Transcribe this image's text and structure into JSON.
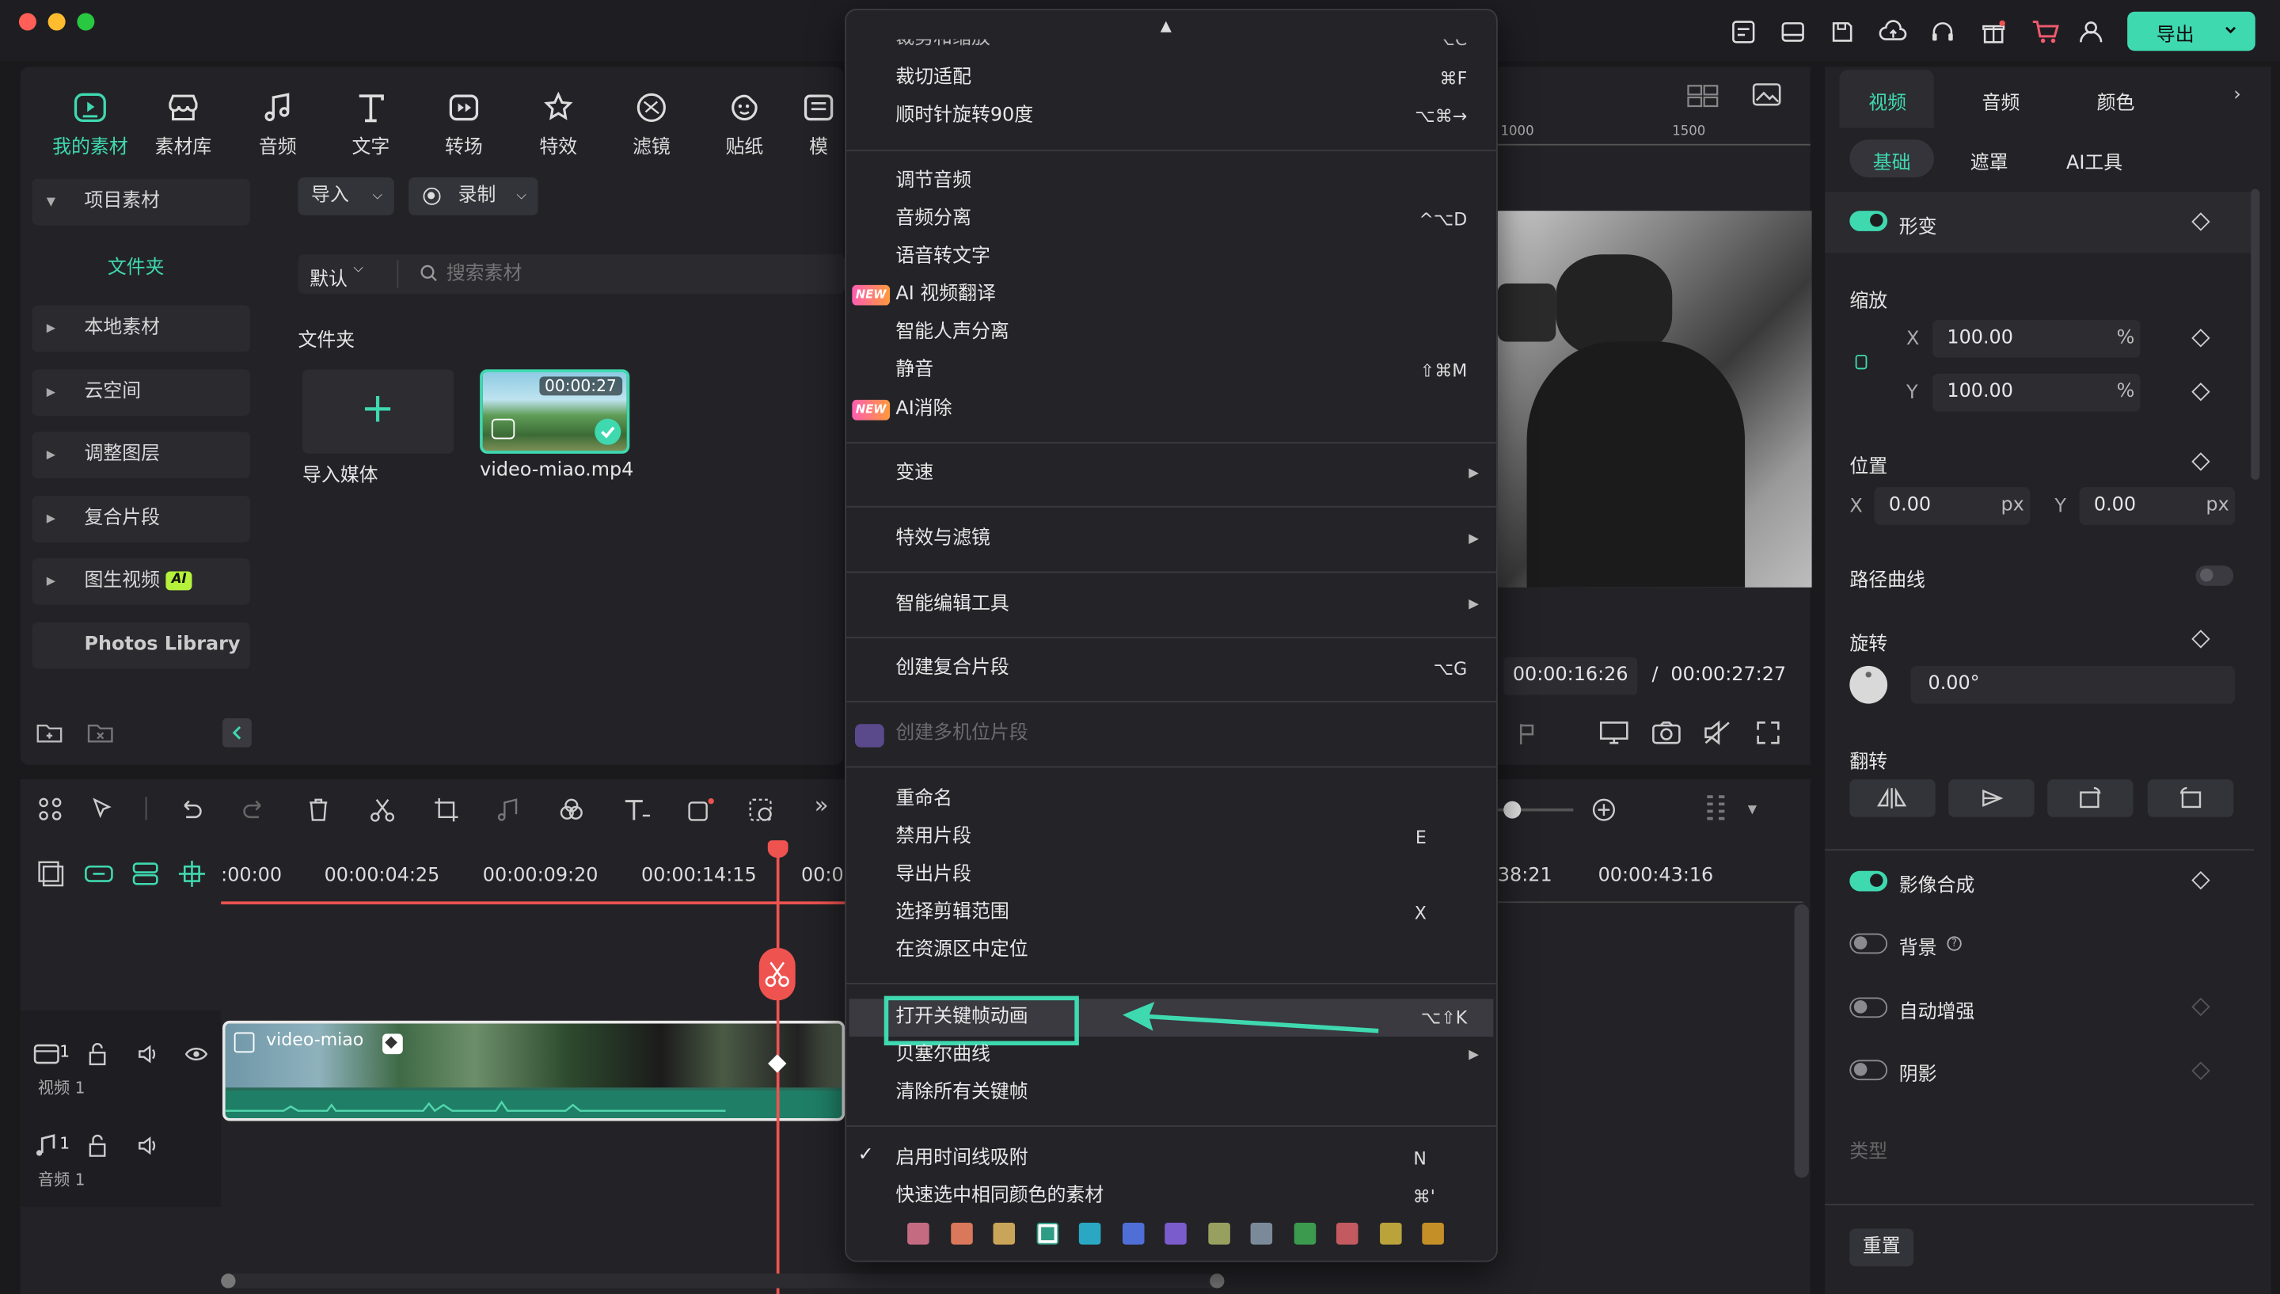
{
  "toolbar": {
    "items": [
      {
        "label": "我的素材",
        "icon": "media-icon"
      },
      {
        "label": "素材库",
        "icon": "library-icon"
      },
      {
        "label": "音频",
        "icon": "music-note-icon"
      },
      {
        "label": "文字",
        "icon": "text-icon"
      },
      {
        "label": "转场",
        "icon": "transition-icon"
      },
      {
        "label": "特效",
        "icon": "effects-icon"
      },
      {
        "label": "滤镜",
        "icon": "filter-icon"
      },
      {
        "label": "贴纸",
        "icon": "sticker-icon"
      },
      {
        "label": "模",
        "icon": "template-icon"
      }
    ],
    "export_label": "导出",
    "accent": "#3fd9b0"
  },
  "sidebar": {
    "project_media": "项目素材",
    "folder": "文件夹",
    "items": [
      "本地素材",
      "云空间",
      "调整图层",
      "复合片段",
      "图生视频",
      "Photos Library"
    ],
    "ai_badge": "AI"
  },
  "media": {
    "import_label": "导入",
    "record_label": "录制",
    "sort_label": "默认",
    "search_placeholder": "搜索素材",
    "folder_heading": "文件夹",
    "import_media_label": "导入媒体",
    "clip_name": "video-miao.mp4",
    "clip_duration": "00:00:27"
  },
  "preview": {
    "ruler": [
      "1000",
      "1500"
    ],
    "current_time": "00:00:16:26",
    "separator": "/",
    "total_time": "00:00:27:27"
  },
  "context_menu": {
    "top_cut": "裁剪和缩放",
    "top_cut_shortcut": "⌥C",
    "groups": [
      [
        {
          "label": "裁切适配",
          "shortcut": "⌘F"
        },
        {
          "label": "顺时针旋转90度",
          "shortcut": "⌥⌘→"
        }
      ],
      [
        {
          "label": "调节音频",
          "shortcut": ""
        },
        {
          "label": "音频分离",
          "shortcut": "^⌥D"
        },
        {
          "label": "语音转文字",
          "shortcut": ""
        },
        {
          "label": "AI 视频翻译",
          "shortcut": "",
          "badge": "NEW"
        },
        {
          "label": "智能人声分离",
          "shortcut": ""
        },
        {
          "label": "静音",
          "shortcut": "⇧⌘M"
        },
        {
          "label": "AI消除",
          "shortcut": "",
          "badge": "NEW"
        }
      ],
      [
        {
          "label": "变速",
          "submenu": true
        }
      ],
      [
        {
          "label": "特效与滤镜",
          "submenu": true
        }
      ],
      [
        {
          "label": "智能编辑工具",
          "submenu": true
        }
      ],
      [
        {
          "label": "创建复合片段",
          "shortcut": "⌥G"
        }
      ],
      [
        {
          "label": "创建多机位片段",
          "disabled": true
        }
      ],
      [
        {
          "label": "重命名",
          "shortcut": ""
        },
        {
          "label": "禁用片段",
          "shortcut": "E"
        },
        {
          "label": "导出片段",
          "shortcut": ""
        },
        {
          "label": "选择剪辑范围",
          "shortcut": "X"
        },
        {
          "label": "在资源区中定位",
          "shortcut": ""
        }
      ],
      [
        {
          "label": "打开关键帧动画",
          "shortcut": "⌥⇧K",
          "highlighted": true
        },
        {
          "label": "贝塞尔曲线",
          "submenu": true
        },
        {
          "label": "清除所有关键帧",
          "shortcut": ""
        }
      ],
      [
        {
          "label": "启用时间线吸附",
          "shortcut": "N",
          "checked": true
        },
        {
          "label": "快速选中相同颜色的素材",
          "shortcut": "⌘'"
        }
      ]
    ],
    "swatches": [
      "#c46b82",
      "#d9785a",
      "#c9a559",
      "#2f9d86",
      "#2aa7c2",
      "#4f6fd6",
      "#7b5ccc",
      "#98a060",
      "#7b8a99",
      "#3b9a4e",
      "#c25a5f",
      "#b9a33a",
      "#c58f28"
    ],
    "selected_swatch": 3
  },
  "inspector": {
    "tabs": [
      "视频",
      "音频",
      "颜色"
    ],
    "subtabs": [
      "基础",
      "遮罩",
      "AI工具"
    ],
    "transform": "形变",
    "scale": "缩放",
    "scale_x": "100.00",
    "scale_y": "100.00",
    "percent": "%",
    "position": "位置",
    "pos_x": "0.00",
    "pos_y": "0.00",
    "px": "px",
    "x": "X",
    "y": "Y",
    "path_curve": "路径曲线",
    "rotate": "旋转",
    "rotate_value": "0.00°",
    "flip": "翻转",
    "compositing": "影像合成",
    "background": "背景",
    "auto_enhance": "自动增强",
    "shadow": "阴影",
    "type": "类型",
    "reset": "重置"
  },
  "timeline": {
    "ticks": [
      ":00:00",
      "00:00:04:25",
      "00:00:09:20",
      "00:00:14:15",
      "00:0",
      "38:21",
      "00:00:43:16"
    ],
    "video_track": "视频 1",
    "audio_track": "音频 1",
    "clip_label": "video-miao",
    "track_num": "1",
    "playhead_color": "#ef5350"
  }
}
